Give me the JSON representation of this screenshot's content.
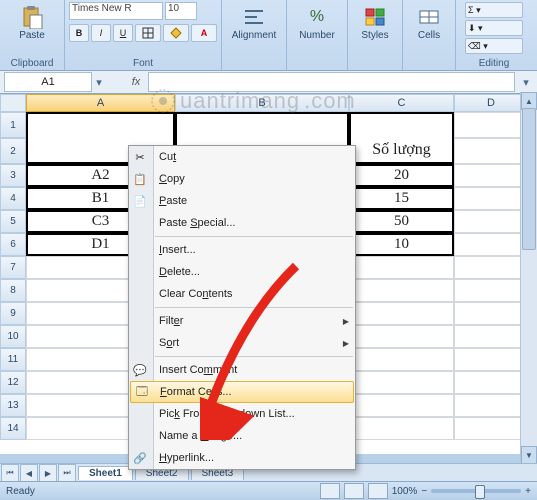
{
  "ribbon": {
    "paste_label": "Paste",
    "group_clipboard": "Clipboard",
    "group_font": "Font",
    "group_alignment": "Alignment",
    "group_number": "Number",
    "group_styles": "Styles",
    "group_cells": "Cells",
    "group_editing": "Editing",
    "font_name": "Times New R",
    "font_size": "10",
    "alignment_label": "Alignment",
    "number_label": "Number",
    "styles_label": "Styles",
    "cells_label": "Cells",
    "editing_label": "Editing"
  },
  "namebox": {
    "value": "A1",
    "fx": "fx"
  },
  "columns": {
    "A": "A",
    "B": "B",
    "C": "C",
    "D": "D"
  },
  "rowheads": [
    "1",
    "2",
    "3",
    "4",
    "5",
    "6",
    "7",
    "8",
    "9",
    "10",
    "11",
    "12",
    "13",
    "14"
  ],
  "table": {
    "header_b": "",
    "header_c": "Số lượng",
    "rows": [
      {
        "a": "A2",
        "c": "20"
      },
      {
        "a": "B1",
        "c": "15"
      },
      {
        "a": "C3",
        "c": "50"
      },
      {
        "a": "D1",
        "c": "10"
      }
    ]
  },
  "tabs": {
    "s1": "Sheet1",
    "s2": "Sheet2",
    "s3": "Sheet3"
  },
  "status": {
    "ready": "Ready",
    "zoom": "100%"
  },
  "context": {
    "cut": "Cut",
    "copy": "Copy",
    "paste": "Paste",
    "paste_special": "Paste Special...",
    "insert": "Insert...",
    "delete": "Delete...",
    "clear": "Clear Contents",
    "filter": "Filter",
    "sort": "Sort",
    "comment": "Insert Comment",
    "format_cells": "Format Cells...",
    "pick": "Pick From Drop-down List...",
    "name_range": "Name a Range...",
    "hyperlink": "Hyperlink..."
  },
  "watermark": "uantrimang"
}
